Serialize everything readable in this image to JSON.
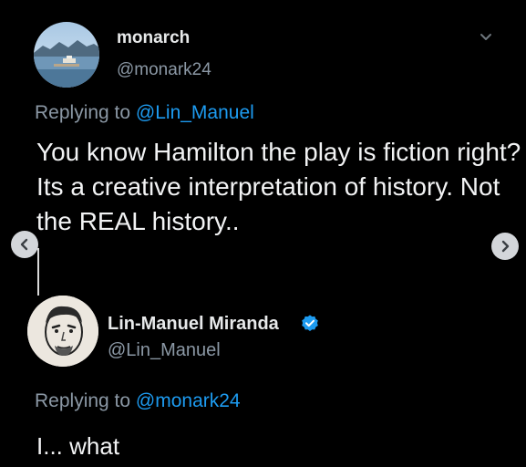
{
  "tweet1": {
    "display_name": "monarch",
    "handle": "@monark24",
    "replying_prefix": "Replying to",
    "replying_mention": "@Lin_Manuel",
    "text": "You know Hamilton the play is fiction right? Its a creative interpretation of history. Not the REAL history.."
  },
  "tweet2": {
    "display_name": "Lin-Manuel Miranda",
    "handle": "@Lin_Manuel",
    "replying_prefix": "Replying to",
    "replying_mention": "@monark24",
    "text": "I... what"
  },
  "icons": {
    "more": "chevron-down-icon",
    "prev": "chevron-left-icon",
    "next": "chevron-right-icon",
    "verified": "verified-badge-icon"
  },
  "colors": {
    "background": "#000000",
    "text": "#e7e9ea",
    "secondary": "#8b98a5",
    "accent": "#1d9bf0"
  }
}
